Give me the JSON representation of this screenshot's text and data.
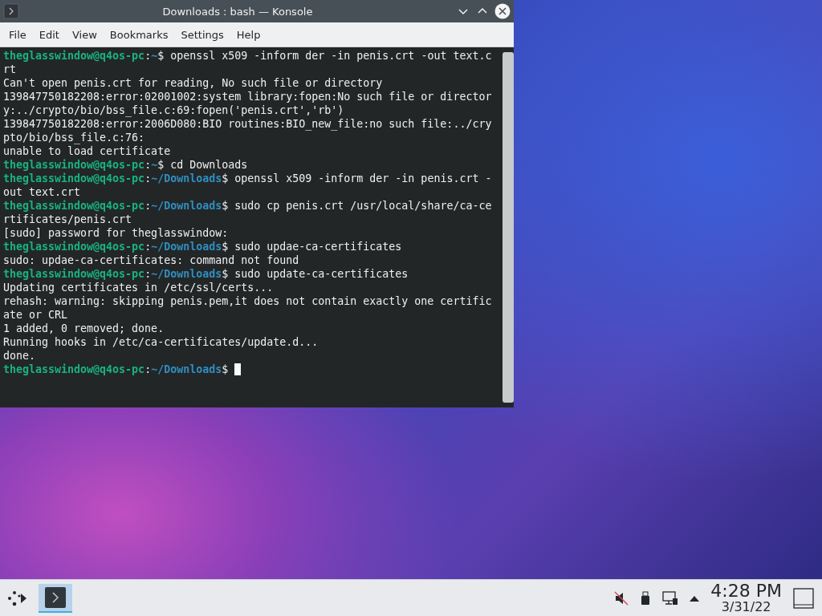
{
  "window": {
    "title": "Downloads : bash — Konsole",
    "menu": [
      "File",
      "Edit",
      "View",
      "Bookmarks",
      "Settings",
      "Help"
    ]
  },
  "terminal": {
    "lines": [
      {
        "kind": "prompt",
        "user": "theglasswindow@q4os-pc",
        "sep": ":",
        "path": "~",
        "command": "$ openssl x509 -inform der -in penis.crt -out text.c"
      },
      {
        "kind": "output",
        "text": "rt"
      },
      {
        "kind": "output",
        "text": "Can't open penis.crt for reading, No such file or directory"
      },
      {
        "kind": "output",
        "text": "139847750182208:error:02001002:system library:fopen:No such file or director"
      },
      {
        "kind": "output",
        "text": "y:../crypto/bio/bss_file.c:69:fopen('penis.crt','rb')"
      },
      {
        "kind": "output",
        "text": "139847750182208:error:2006D080:BIO routines:BIO_new_file:no such file:../cry"
      },
      {
        "kind": "output",
        "text": "pto/bio/bss_file.c:76:"
      },
      {
        "kind": "output",
        "text": "unable to load certificate"
      },
      {
        "kind": "prompt",
        "user": "theglasswindow@q4os-pc",
        "sep": ":",
        "path": "~",
        "command": "$ cd Downloads"
      },
      {
        "kind": "prompt",
        "user": "theglasswindow@q4os-pc",
        "sep": ":",
        "path": "~/Downloads",
        "command": "$ openssl x509 -inform der -in penis.crt -"
      },
      {
        "kind": "output",
        "text": "out text.crt"
      },
      {
        "kind": "prompt",
        "user": "theglasswindow@q4os-pc",
        "sep": ":",
        "path": "~/Downloads",
        "command": "$ sudo cp penis.crt /usr/local/share/ca-ce"
      },
      {
        "kind": "output",
        "text": "rtificates/penis.crt"
      },
      {
        "kind": "output",
        "text": "[sudo] password for theglasswindow:"
      },
      {
        "kind": "prompt",
        "user": "theglasswindow@q4os-pc",
        "sep": ":",
        "path": "~/Downloads",
        "command": "$ sudo updae-ca-certificates"
      },
      {
        "kind": "output",
        "text": "sudo: updae-ca-certificates: command not found"
      },
      {
        "kind": "prompt",
        "user": "theglasswindow@q4os-pc",
        "sep": ":",
        "path": "~/Downloads",
        "command": "$ sudo update-ca-certificates"
      },
      {
        "kind": "output",
        "text": "Updating certificates in /etc/ssl/certs..."
      },
      {
        "kind": "output",
        "text": "rehash: warning: skipping penis.pem,it does not contain exactly one certific"
      },
      {
        "kind": "output",
        "text": "ate or CRL"
      },
      {
        "kind": "output",
        "text": "1 added, 0 removed; done."
      },
      {
        "kind": "output",
        "text": "Running hooks in /etc/ca-certificates/update.d..."
      },
      {
        "kind": "output",
        "text": "done."
      },
      {
        "kind": "prompt",
        "user": "theglasswindow@q4os-pc",
        "sep": ":",
        "path": "~/Downloads",
        "command": "$",
        "cursor": true
      }
    ]
  },
  "taskbar": {
    "tasks": [
      {
        "selected": true
      }
    ],
    "clock": {
      "time": "4:28 PM",
      "date": "3/31/22"
    }
  }
}
